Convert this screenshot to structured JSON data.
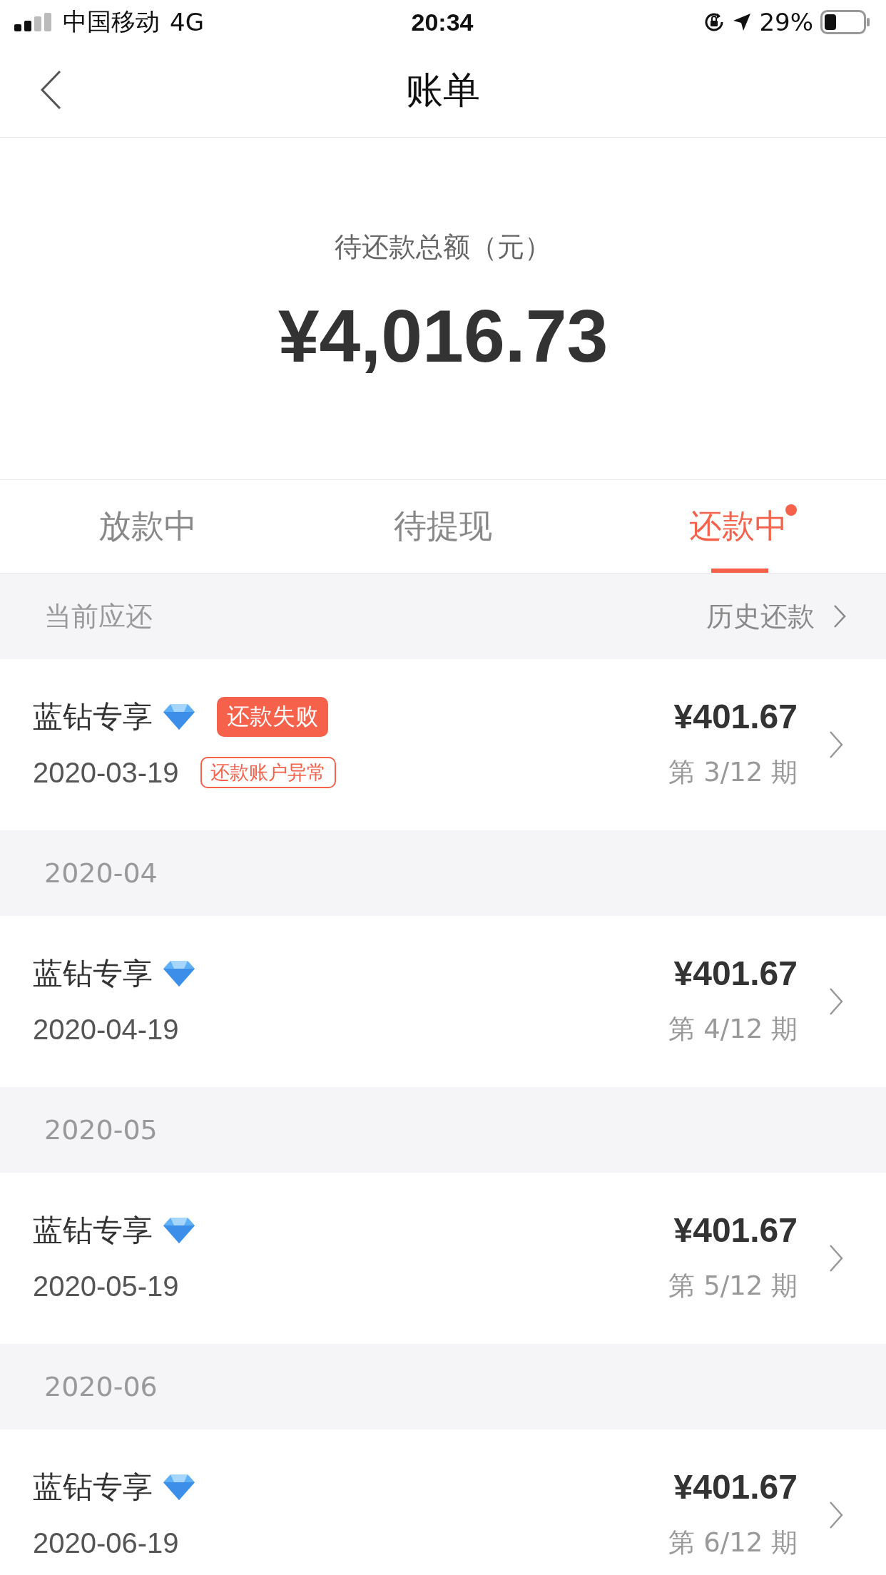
{
  "status_bar": {
    "carrier": "中国移动",
    "network": "4G",
    "time": "20:34",
    "battery_text": "29%"
  },
  "nav": {
    "title": "账单"
  },
  "summary": {
    "label": "待还款总额（元）",
    "amount": "¥4,016.73"
  },
  "tabs": [
    {
      "label": "放款中",
      "selected": false,
      "dot": false
    },
    {
      "label": "待提现",
      "selected": false,
      "dot": false
    },
    {
      "label": "还款中",
      "selected": true,
      "dot": true
    }
  ],
  "current_header": {
    "title": "当前应还",
    "link": "历史还款"
  },
  "groups": [
    {
      "items": [
        {
          "name": "蓝钻专享",
          "date": "2020-03-19",
          "amount": "¥401.67",
          "period": "第 3/12 期",
          "badge": "还款失败",
          "tag": "还款账户异常"
        }
      ]
    },
    {
      "month": "2020-04",
      "items": [
        {
          "name": "蓝钻专享",
          "date": "2020-04-19",
          "amount": "¥401.67",
          "period": "第 4/12 期"
        }
      ]
    },
    {
      "month": "2020-05",
      "items": [
        {
          "name": "蓝钻专享",
          "date": "2020-05-19",
          "amount": "¥401.67",
          "period": "第 5/12 期"
        }
      ]
    },
    {
      "month": "2020-06",
      "items": [
        {
          "name": "蓝钻专享",
          "date": "2020-06-19",
          "amount": "¥401.67",
          "period": "第 6/12 期"
        }
      ]
    }
  ]
}
